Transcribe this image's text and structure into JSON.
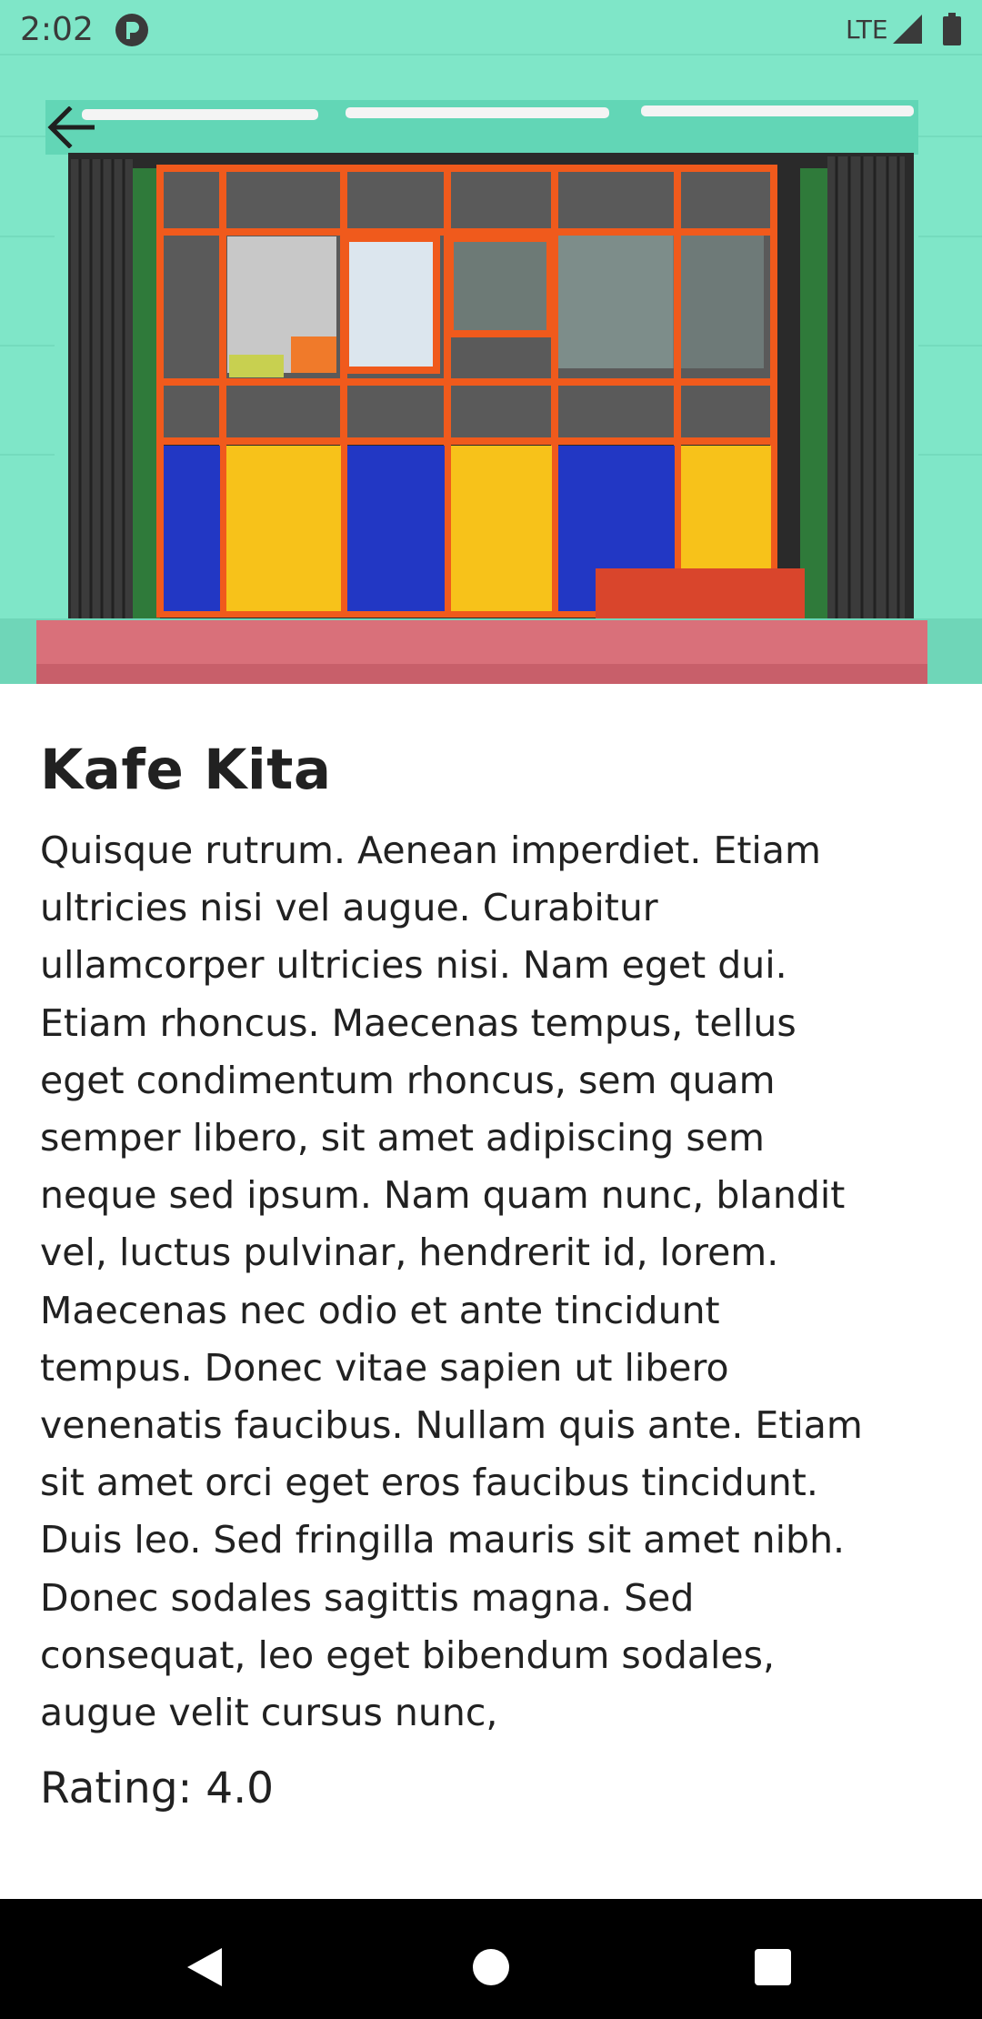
{
  "status_bar": {
    "time": "2:02",
    "network": "LTE",
    "icons": [
      "app-notification-icon",
      "signal-icon",
      "battery-icon"
    ]
  },
  "header": {
    "back_icon": "arrow-left-icon"
  },
  "hero": {
    "image": "colorful-storefront-photo"
  },
  "place": {
    "name": "Kafe Kita",
    "description": "Quisque rutrum. Aenean imperdiet. Etiam\nultricies nisi vel augue. Curabitur\nullamcorper ultricies nisi. Nam eget dui.\nEtiam rhoncus. Maecenas tempus, tellus\neget condimentum rhoncus, sem quam\nsemper libero, sit amet adipiscing sem\nneque sed ipsum. Nam quam nunc, blandit\nvel, luctus pulvinar, hendrerit id, lorem.\nMaecenas nec odio et ante tincidunt\ntempus. Donec vitae sapien ut libero\nvenenatis faucibus. Nullam quis ante. Etiam\nsit amet orci eget eros faucibus tincidunt.\nDuis leo. Sed fringilla mauris sit amet nibh.\nDonec sodales sagittis magna. Sed\nconsequat, leo eget bibendum sodales,\naugue velit cursus nunc,",
    "rating_label": "Rating: 4.0"
  },
  "nav_bar": {
    "buttons": [
      "back-triangle-icon",
      "home-circle-icon",
      "recents-square-icon"
    ]
  },
  "colors": {
    "wall": "#7fe6c8",
    "frame_orange": "#f05a1c",
    "panel_yellow": "#f7c21a",
    "panel_blue": "#2237c4",
    "step_pink": "#d9707a",
    "text": "#212121"
  }
}
